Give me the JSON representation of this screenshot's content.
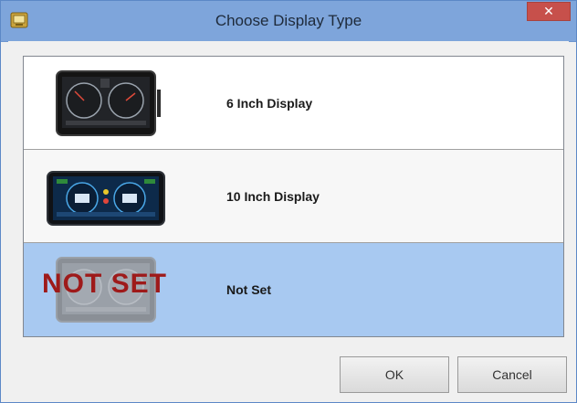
{
  "window": {
    "title": "Choose Display Type",
    "close_glyph": "✕",
    "app_icon": "app-icon",
    "accent_color": "#7ea5db"
  },
  "options": [
    {
      "label": "6 Inch Display",
      "thumb_icon": "6-inch-display-thumbnail",
      "selected": false
    },
    {
      "label": "10 Inch Display",
      "thumb_icon": "10-inch-display-thumbnail",
      "selected": false
    },
    {
      "label": "Not Set",
      "thumb_icon": "not-set-thumbnail",
      "overlay_text": "NOT SET",
      "selected": true
    }
  ],
  "buttons": {
    "ok_label": "OK",
    "cancel_label": "Cancel"
  },
  "colors": {
    "selected_row": "#a8c9f1",
    "not_set_overlay": "#9e1a1a"
  }
}
